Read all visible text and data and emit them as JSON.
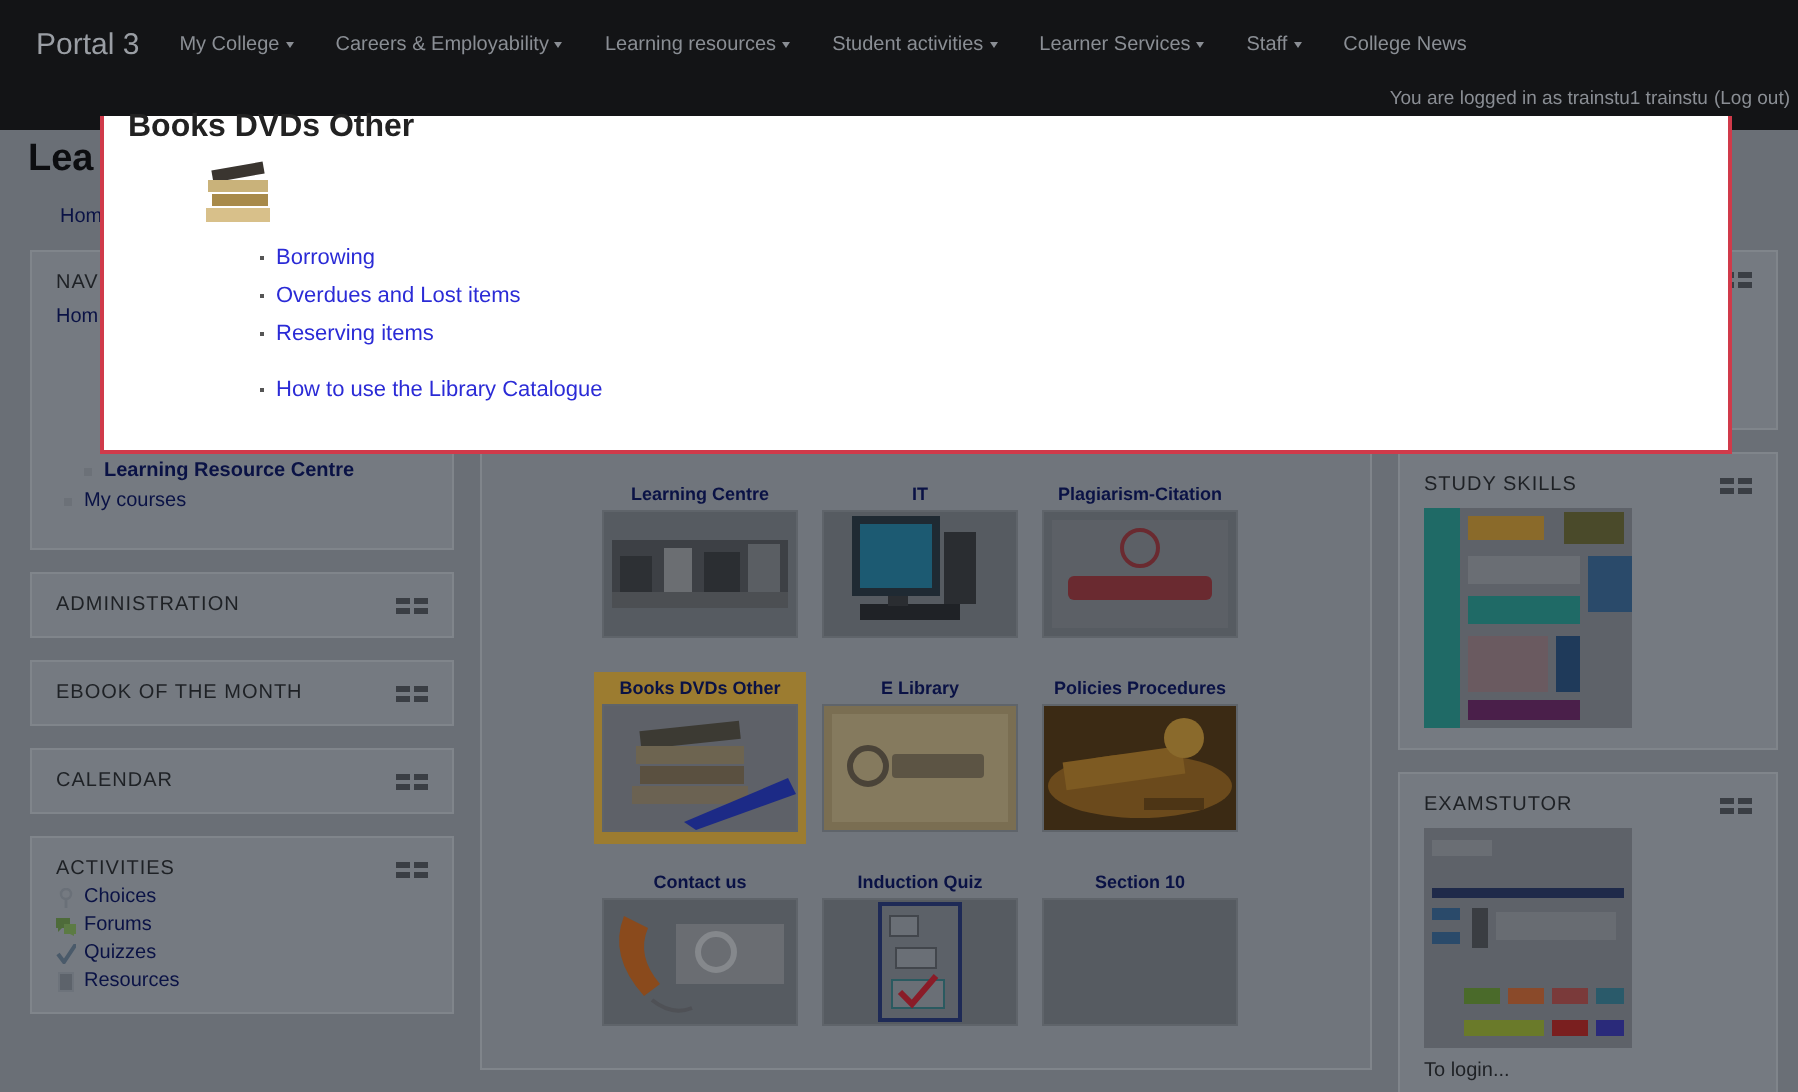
{
  "navbar": {
    "brand": "Portal 3",
    "menus": [
      {
        "label": "My College",
        "dropdown": true
      },
      {
        "label": "Careers & Employability",
        "dropdown": true
      },
      {
        "label": "Learning resources",
        "dropdown": true
      },
      {
        "label": "Student activities",
        "dropdown": true
      },
      {
        "label": "Learner Services",
        "dropdown": true
      },
      {
        "label": "Staff",
        "dropdown": true
      },
      {
        "label": "College News",
        "dropdown": false
      }
    ],
    "login_text": "You are logged in as trainstu1 trainstu",
    "logout_link": "(Log out)"
  },
  "page": {
    "heading": "Lea",
    "breadcrumb": "Hom"
  },
  "navigation_block": {
    "title": "NAV",
    "home": "Hom",
    "items": [
      {
        "label": "Learning Resource Centre",
        "current": true
      },
      {
        "label": "My courses",
        "current": false
      }
    ]
  },
  "left_blocks": [
    {
      "title": "ADMINISTRATION"
    },
    {
      "title": "EBOOK OF THE MONTH"
    },
    {
      "title": "CALENDAR"
    },
    {
      "title": "ACTIVITIES",
      "items": [
        {
          "label": "Choices",
          "kind": "choice"
        },
        {
          "label": "Forums",
          "kind": "forum"
        },
        {
          "label": "Quizzes",
          "kind": "quiz"
        },
        {
          "label": "Resources",
          "kind": "resource"
        }
      ]
    }
  ],
  "tiles": [
    {
      "title": "Learning Centre",
      "kind": "picture",
      "selected": false
    },
    {
      "title": "IT",
      "kind": "picture",
      "selected": false
    },
    {
      "title": "Plagiarism-Citation",
      "kind": "picture",
      "selected": false
    },
    {
      "title": "Books DVDs Other",
      "kind": "picture",
      "selected": true
    },
    {
      "title": "E Library",
      "kind": "picture",
      "selected": false
    },
    {
      "title": "Policies Procedures",
      "kind": "picture",
      "selected": false
    },
    {
      "title": "Contact us",
      "kind": "picture",
      "selected": false
    },
    {
      "title": "Induction Quiz",
      "kind": "picture",
      "selected": false
    },
    {
      "title": "Section 10",
      "kind": "empty",
      "selected": false
    }
  ],
  "right_blocks": [
    {
      "title": "STUDY SKILLS"
    },
    {
      "title": "EXAMSTUTOR",
      "caption": "To login..."
    }
  ],
  "modal": {
    "title": "Books DVDs Other",
    "link_groups": [
      {
        "links": [
          "Borrowing",
          "Overdues and Lost items",
          "Reserving items"
        ]
      },
      {
        "links": [
          "How to use the Library Catalogue"
        ]
      }
    ]
  }
}
